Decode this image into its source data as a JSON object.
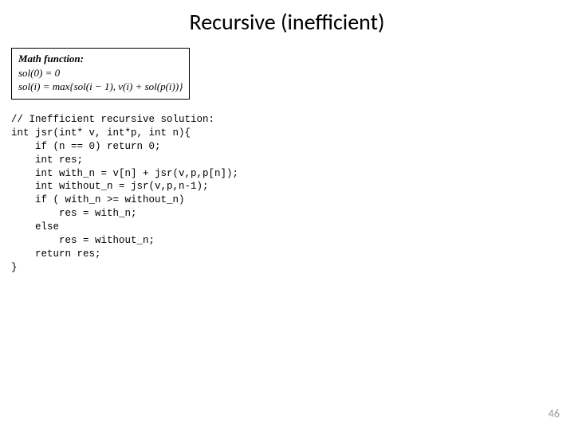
{
  "title": "Recursive (inefficient)",
  "math": {
    "label": "Math function:",
    "line1": "sol(0) = 0",
    "line2": "sol(i) = max{sol(i − 1), v(i) + sol(p(i))}"
  },
  "code": {
    "l1": "// Inefficient recursive solution:",
    "l2": "int jsr(int* v, int*p, int n){",
    "l3": "    if (n == 0) return 0;",
    "l4": "    int res;",
    "l5": "    int with_n = v[n] + jsr(v,p,p[n]);",
    "l6": "    int without_n = jsr(v,p,n-1);",
    "l7": "    if ( with_n >= without_n)",
    "l8": "        res = with_n;",
    "l9": "    else",
    "l10": "        res = without_n;",
    "l11": "    return res;",
    "l12": "}"
  },
  "page_number": "46"
}
